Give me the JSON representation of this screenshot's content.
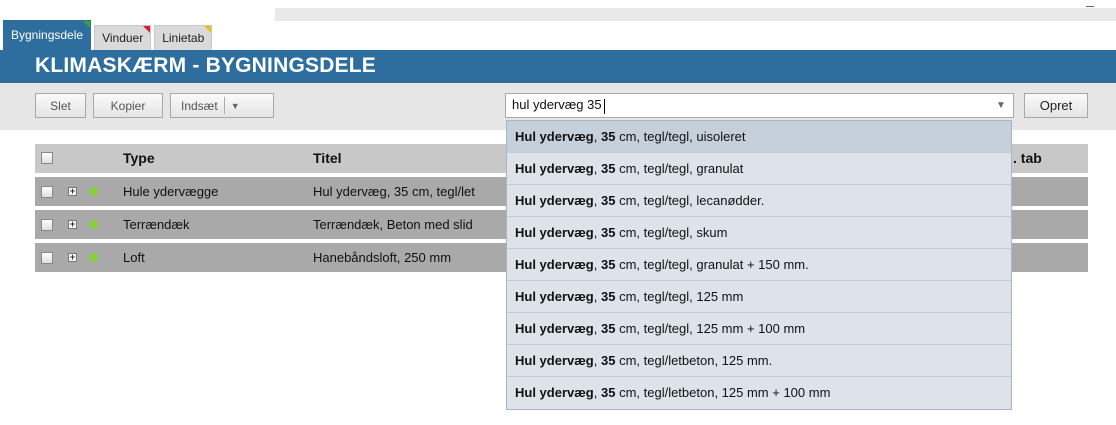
{
  "tabs": [
    {
      "label": "Bygningsdele",
      "active": true,
      "flag_color": "#3aa23a"
    },
    {
      "label": "Vinduer",
      "active": false,
      "flag_color": "#d9202a"
    },
    {
      "label": "Linietab",
      "active": false,
      "flag_color": "#e8c21a"
    }
  ],
  "header": {
    "title": "KLIMASKÆRM - BYGNINGSDELE"
  },
  "toolbar": {
    "delete_label": "Slet",
    "copy_label": "Kopier",
    "insert_label": "Indsæt",
    "create_label": "Opret",
    "search_value": "hul ydervæg 35"
  },
  "table": {
    "headers": {
      "type": "Type",
      "title": "Titel",
      "right": ". tab"
    },
    "rows": [
      {
        "type": "Hule ydervægge",
        "title": "Hul ydervæg, 35 cm, tegl/let"
      },
      {
        "type": "Terrændæk",
        "title": "Terrændæk, Beton med slid"
      },
      {
        "type": "Loft",
        "title": "Hanebåndsloft, 250 mm"
      }
    ]
  },
  "suggestions": [
    {
      "b1": "Hul ydervæg",
      "sep": ", ",
      "b2": "35",
      "rest": " cm, tegl/tegl, uisoleret"
    },
    {
      "b1": "Hul ydervæg",
      "sep": ", ",
      "b2": "35",
      "rest": " cm, tegl/tegl, granulat"
    },
    {
      "b1": "Hul ydervæg",
      "sep": ", ",
      "b2": "35",
      "rest": " cm, tegl/tegl, lecanødder."
    },
    {
      "b1": "Hul ydervæg",
      "sep": ", ",
      "b2": "35",
      "rest": " cm, tegl/tegl, skum"
    },
    {
      "b1": "Hul ydervæg",
      "sep": ", ",
      "b2": "35",
      "rest": " cm, tegl/tegl, granulat + 150 mm."
    },
    {
      "b1": "Hul ydervæg",
      "sep": ", ",
      "b2": "35",
      "rest": " cm, tegl/tegl, 125 mm"
    },
    {
      "b1": "Hul ydervæg",
      "sep": ", ",
      "b2": "35",
      "rest": " cm, tegl/tegl, 125 mm + 100 mm"
    },
    {
      "b1": "Hul ydervæg",
      "sep": ", ",
      "b2": "35",
      "rest": " cm, tegl/letbeton, 125 mm."
    },
    {
      "b1": "Hul ydervæg",
      "sep": ", ",
      "b2": "35",
      "rest": " cm, tegl/letbeton, 125 mm + 100 mm"
    }
  ],
  "colors": {
    "brand": "#2e6e9e",
    "status_dot": "#86d13b"
  }
}
